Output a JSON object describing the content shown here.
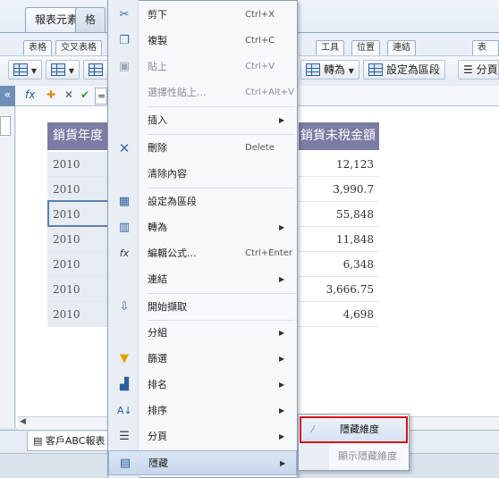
{
  "ribbon": {
    "tabs": [
      {
        "label": "報表元素"
      },
      {
        "label": "格"
      }
    ],
    "sub_tabs": [
      "表格",
      "交叉表格",
      "工具",
      "位置",
      "連結",
      "表格範"
    ],
    "tools": {
      "convert_label": "轉為",
      "set_section_label": "設定為區段",
      "paging_label": "分頁"
    }
  },
  "formula": {
    "fx": "fx",
    "value_prefix": "="
  },
  "left_panel": {
    "collapse": "«"
  },
  "table": {
    "col_year_header": "銷貨年度",
    "col_amount_header": "銷貨未稅金額",
    "years": [
      "2010",
      "2010",
      "2010",
      "2010",
      "2010",
      "2010",
      "2010"
    ],
    "amounts": [
      "12,123",
      "3,990.7",
      "55,848",
      "11,848",
      "6,348",
      "3,666.75",
      "4,698"
    ]
  },
  "sheet_tab": {
    "label": "客戶ABC報表"
  },
  "context_menu": {
    "items": [
      {
        "label": "剪下",
        "shortcut": "Ctrl+X",
        "icon": "cut-icon"
      },
      {
        "label": "複製",
        "shortcut": "Ctrl+C",
        "icon": "copy-icon"
      },
      {
        "label": "貼上",
        "shortcut": "Ctrl+V",
        "icon": "paste-icon"
      },
      {
        "label": "選擇性貼上...",
        "shortcut": "Ctrl+Alt+V"
      },
      {
        "label": "插入",
        "icon": "none"
      },
      {
        "label": "刪除",
        "shortcut": "Delete",
        "icon": "delete-icon"
      },
      {
        "label": "清除內容"
      },
      {
        "label": "設定為區段",
        "icon": "section-icon"
      },
      {
        "label": "轉為",
        "icon": "convert-icon"
      },
      {
        "label": "編輯公式...",
        "shortcut": "Ctrl+Enter",
        "icon": "formula-icon"
      },
      {
        "label": "連結"
      },
      {
        "label": "開始擷取",
        "icon": "drill-icon"
      },
      {
        "label": "分組"
      },
      {
        "label": "篩選",
        "icon": "filter-icon"
      },
      {
        "label": "排名",
        "icon": "rank-icon"
      },
      {
        "label": "排序",
        "icon": "sort-icon"
      },
      {
        "label": "分頁",
        "icon": "paging-icon"
      },
      {
        "label": "隱藏",
        "icon": "hide-icon"
      }
    ]
  },
  "submenu": {
    "hide_dimension": "隱藏維度",
    "show_hidden_dimension": "顯示隱藏維度"
  },
  "colors": {
    "header_bg": "#7c7ba3",
    "highlight": "#d8141a",
    "accent": "#5b7fb0"
  }
}
